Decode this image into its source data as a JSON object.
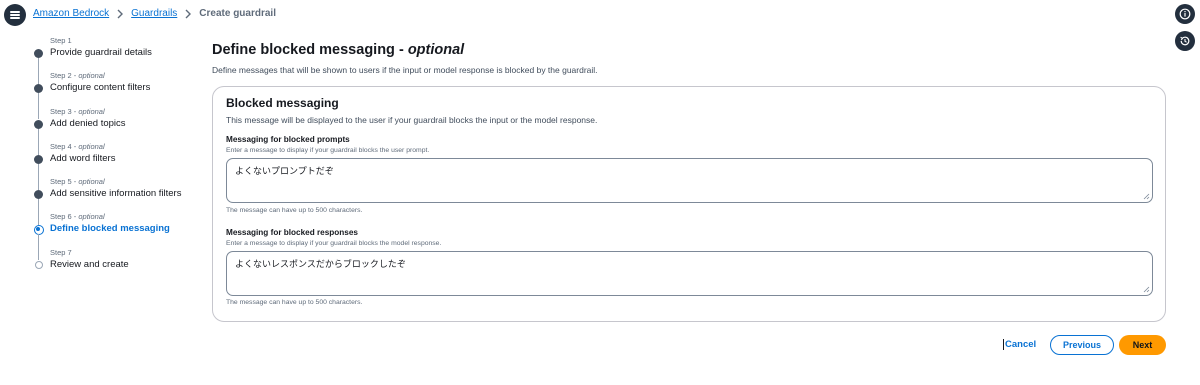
{
  "breadcrumb": {
    "items": [
      "Amazon Bedrock",
      "Guardrails"
    ],
    "current": "Create guardrail"
  },
  "icons": {
    "menu": "hamburger-menu-icon",
    "info": "info-icon",
    "history": "history-icon",
    "separator": "chevron-right-icon"
  },
  "steps": [
    {
      "number": "Step 1",
      "optional": "",
      "label": "Provide guardrail details",
      "state": "done"
    },
    {
      "number": "Step 2 - ",
      "optional": "optional",
      "label": "Configure content filters",
      "state": "done"
    },
    {
      "number": "Step 3 - ",
      "optional": "optional",
      "label": "Add denied topics",
      "state": "done"
    },
    {
      "number": "Step 4 - ",
      "optional": "optional",
      "label": "Add word filters",
      "state": "done"
    },
    {
      "number": "Step 5 - ",
      "optional": "optional",
      "label": "Add sensitive information filters",
      "state": "done"
    },
    {
      "number": "Step 6 - ",
      "optional": "optional",
      "label": "Define blocked messaging",
      "state": "active"
    },
    {
      "number": "Step 7",
      "optional": "",
      "label": "Review and create",
      "state": "todo"
    }
  ],
  "page": {
    "title": "Define blocked messaging - ",
    "title_optional": "optional",
    "description": "Define messages that will be shown to users if the input or model response is blocked by the guardrail."
  },
  "panel": {
    "title": "Blocked messaging",
    "description": "This message will be displayed to the user if your guardrail blocks the input or the model response.",
    "prompts": {
      "label": "Messaging for blocked prompts",
      "hint": "Enter a message to display if your guardrail blocks the user prompt.",
      "value": "よくないプロンプトだぞ",
      "constraint": "The message can have up to 500 characters."
    },
    "responses": {
      "label": "Messaging for blocked responses",
      "hint": "Enter a message to display if your guardrail blocks the model response.",
      "value": "よくないレスポンスだからブロックしたぞ",
      "constraint": "The message can have up to 500 characters."
    }
  },
  "actions": {
    "cancel": "Cancel",
    "previous": "Previous",
    "next": "Next"
  },
  "colors": {
    "link": "#0972d3",
    "primary_button": "#ff9900",
    "nav_dark": "#232f3e"
  }
}
